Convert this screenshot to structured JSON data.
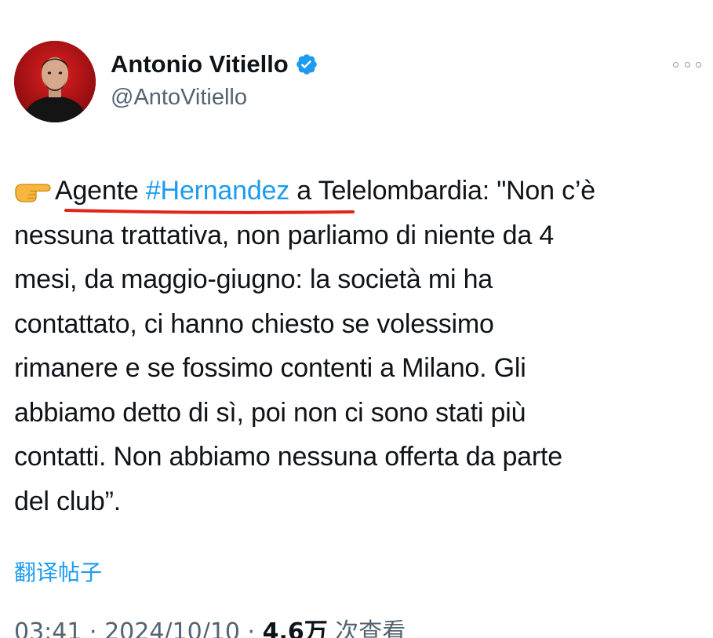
{
  "author": {
    "display_name": "Antonio Vitiello",
    "handle": "@AntoVitiello",
    "verified": true
  },
  "tweet": {
    "line1_before": "Agente ",
    "line1_hashtag": "#Hernandez",
    "line1_after": " a Telelombardia: \"Non c’è",
    "line2": "nessuna trattativa, non parliamo di niente da 4",
    "line3": "mesi, da maggio-giugno: la società mi ha",
    "line4": "contattato, ci hanno chiesto se volessimo",
    "line5": "rimanere e se fossimo contenti a Milano. Gli",
    "line6": "abbiamo detto di sì, poi non ci sono stati più",
    "line7": "contatti. Non abbiamo nessuna offerta da parte",
    "line8": "del club”."
  },
  "translate_label": "翻译帖子",
  "meta": {
    "time": "03:41",
    "separator": " · ",
    "date": "2024/10/10",
    "views_count": "4.6万",
    "views_label": " 次查看"
  },
  "colors": {
    "accent": "#1d9bf0",
    "underline": "#e0251b",
    "text": "#0f1419",
    "secondary": "#536471"
  },
  "icons": {
    "verified": "verified-badge-icon",
    "more": "more-options-icon",
    "emoji": "backhand-index-pointing-right-icon"
  }
}
